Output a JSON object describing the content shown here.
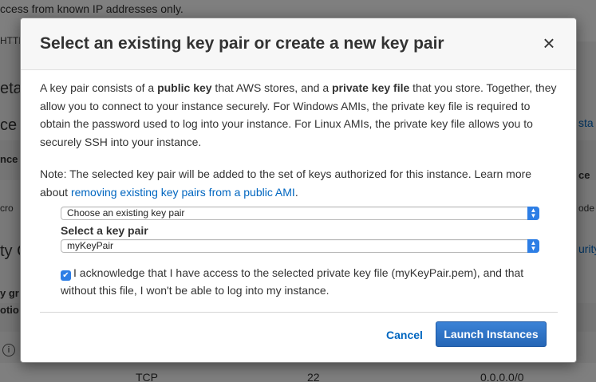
{
  "background": {
    "top_text": "ccess from known IP addresses only.",
    "row_http": "HTTP",
    "left_fragments": [
      "eta",
      "ce",
      "nce",
      "cro",
      "ty C",
      "y gr",
      "otio",
      "i"
    ],
    "right_fragments": [
      "sta",
      "ce",
      "ode",
      "urity"
    ],
    "bottom_cells": [
      "TCP",
      "22",
      "0.0.0.0/0"
    ]
  },
  "modal": {
    "title": "Select an existing key pair or create a new key pair",
    "close_symbol": "×",
    "intro": {
      "t1": "A key pair consists of a ",
      "b1": "public key",
      "t2": " that AWS stores, and a ",
      "b2": "private key file",
      "t3": " that you store. Together, they allow you to connect to your instance securely. For Windows AMIs, the private key file is required to obtain the password used to log into your instance. For Linux AMIs, the private key file allows you to securely SSH into your instance."
    },
    "note": {
      "text": "Note: The selected key pair will be added to the set of keys authorized for this instance. Learn more about ",
      "link": "removing existing key pairs from a public AMI",
      "end": "."
    },
    "key_pair_option": "Choose an existing key pair",
    "select_key_pair_label": "Select a key pair",
    "selected_key_pair": "myKeyPair",
    "acknowledge_text": "I acknowledge that I have access to the selected private key file (myKeyPair.pem), and that without this file, I won't be able to log into my instance.",
    "acknowledge_checked": true,
    "cancel_label": "Cancel",
    "launch_label": "Launch Instances"
  },
  "colors": {
    "accent": "#2d6fc0",
    "link": "#0066c0"
  }
}
